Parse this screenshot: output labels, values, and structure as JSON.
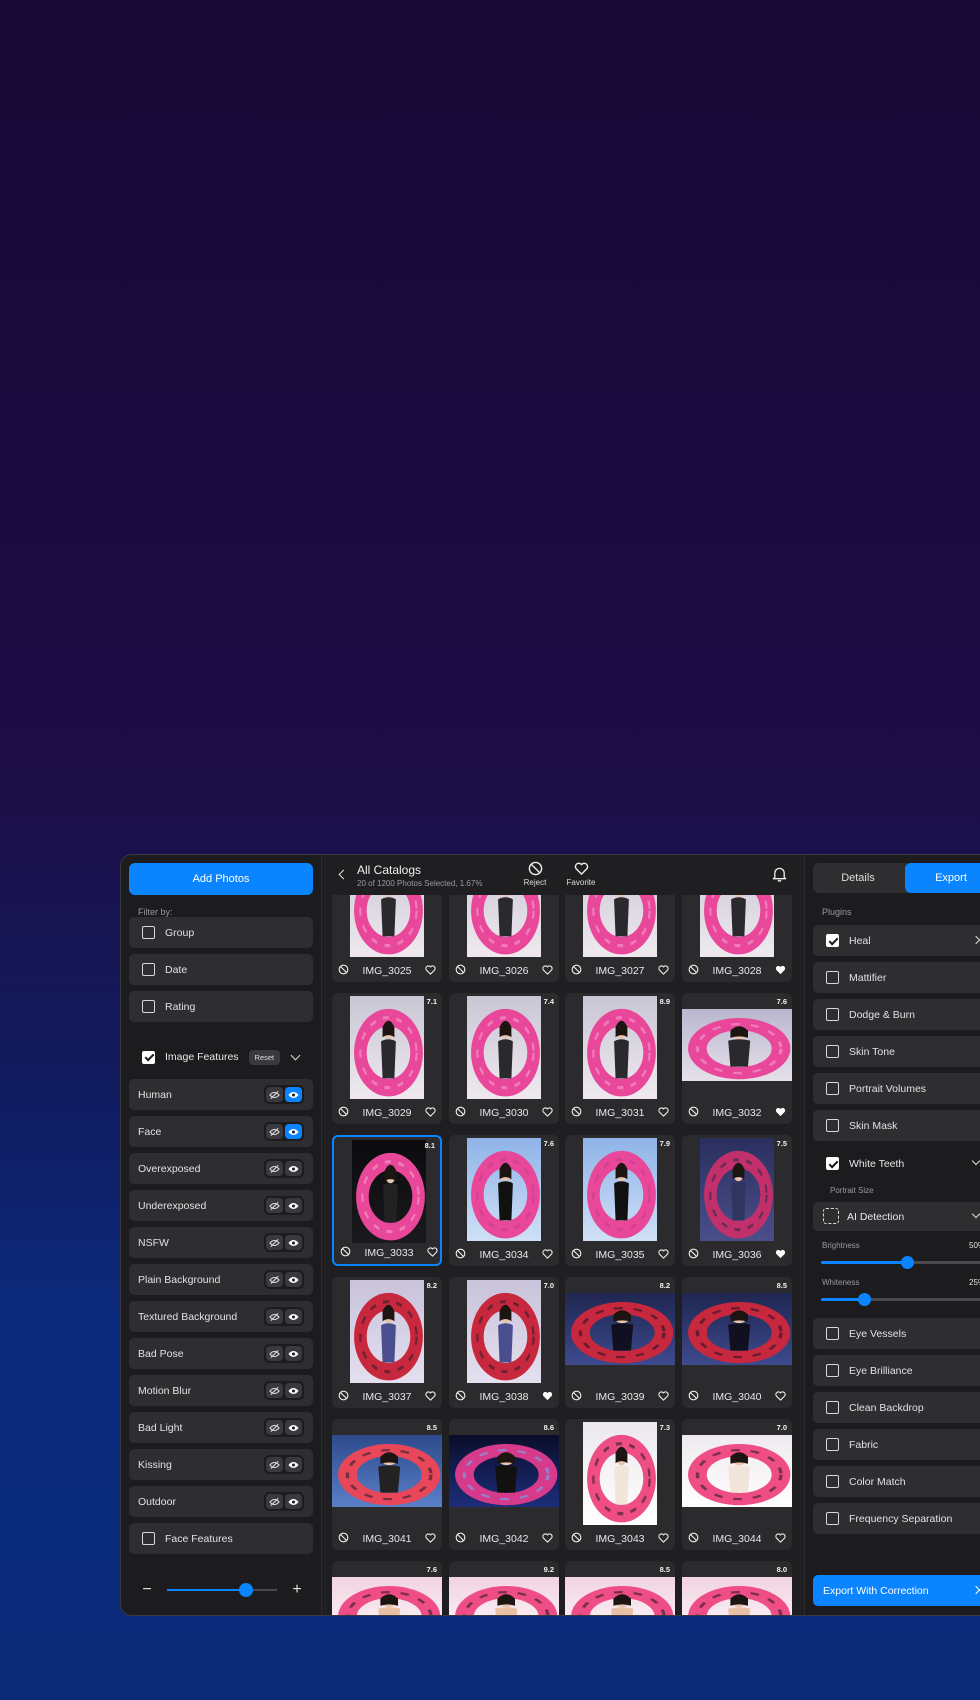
{
  "sidebar": {
    "add_photos": "Add Photos",
    "filter_by": "Filter by:",
    "filters": [
      {
        "label": "Group",
        "checked": false
      },
      {
        "label": "Date",
        "checked": false
      },
      {
        "label": "Rating",
        "checked": false
      }
    ],
    "image_features": {
      "label": "Image Features",
      "checked": true,
      "reset": "Reset"
    },
    "features": [
      {
        "label": "Human",
        "visible": true
      },
      {
        "label": "Face",
        "visible": true
      },
      {
        "label": "Overexposed",
        "visible": false
      },
      {
        "label": "Underexposed",
        "visible": false
      },
      {
        "label": "NSFW",
        "visible": false
      },
      {
        "label": "Plain Background",
        "visible": false
      },
      {
        "label": "Textured Background",
        "visible": false
      },
      {
        "label": "Bad Pose",
        "visible": false
      },
      {
        "label": "Motion Blur",
        "visible": false
      },
      {
        "label": "Bad Light",
        "visible": false
      },
      {
        "label": "Kissing",
        "visible": false
      },
      {
        "label": "Outdoor",
        "visible": false
      }
    ],
    "face_features": {
      "label": "Face Features",
      "checked": false
    },
    "zoom": {
      "minus": "−",
      "plus": "+",
      "level": 0.72
    }
  },
  "header": {
    "title": "All Catalogs",
    "subtitle": "20 of 1200 Photos Selected, 1.67%",
    "reject": "Reject",
    "favorite": "Favorite"
  },
  "photos": [
    {
      "name": "IMG_3025",
      "score": "",
      "fav": false,
      "tone": "light"
    },
    {
      "name": "IMG_3026",
      "score": "",
      "fav": false,
      "tone": "light"
    },
    {
      "name": "IMG_3027",
      "score": "",
      "fav": false,
      "tone": "light"
    },
    {
      "name": "IMG_3028",
      "score": "",
      "fav": true,
      "tone": "light"
    },
    {
      "name": "IMG_3029",
      "score": "7.1",
      "fav": false,
      "tone": "light"
    },
    {
      "name": "IMG_3030",
      "score": "7.4",
      "fav": false,
      "tone": "light"
    },
    {
      "name": "IMG_3031",
      "score": "8.9",
      "fav": false,
      "tone": "light"
    },
    {
      "name": "IMG_3032",
      "score": "7.6",
      "fav": true,
      "tone": "wide-light"
    },
    {
      "name": "IMG_3033",
      "score": "8.1",
      "fav": false,
      "tone": "dark",
      "selected": true
    },
    {
      "name": "IMG_3034",
      "score": "7.6",
      "fav": false,
      "tone": "blue"
    },
    {
      "name": "IMG_3035",
      "score": "7.9",
      "fav": false,
      "tone": "blue"
    },
    {
      "name": "IMG_3036",
      "score": "7.5",
      "fav": true,
      "tone": "navy"
    },
    {
      "name": "IMG_3037",
      "score": "8.2",
      "fav": false,
      "tone": "ring"
    },
    {
      "name": "IMG_3038",
      "score": "7.0",
      "fav": true,
      "tone": "ring"
    },
    {
      "name": "IMG_3039",
      "score": "8.2",
      "fav": false,
      "tone": "wide-navy"
    },
    {
      "name": "IMG_3040",
      "score": "8.5",
      "fav": false,
      "tone": "wide-navy"
    },
    {
      "name": "IMG_3041",
      "score": "8.5",
      "fav": false,
      "tone": "wide-ring"
    },
    {
      "name": "IMG_3042",
      "score": "8.6",
      "fav": false,
      "tone": "wide-dark"
    },
    {
      "name": "IMG_3043",
      "score": "7.3",
      "fav": false,
      "tone": "flamingo"
    },
    {
      "name": "IMG_3044",
      "score": "7.0",
      "fav": false,
      "tone": "wide-flamingo"
    },
    {
      "name": "",
      "score": "7.6",
      "fav": false,
      "tone": "wide-face"
    },
    {
      "name": "",
      "score": "9.2",
      "fav": false,
      "tone": "wide-face"
    },
    {
      "name": "",
      "score": "8.5",
      "fav": false,
      "tone": "wide-face"
    },
    {
      "name": "",
      "score": "8.0",
      "fav": false,
      "tone": "wide-face"
    }
  ],
  "right_panel": {
    "tabs": [
      "Details",
      "Export"
    ],
    "active_tab": "Export",
    "plugins_label": "Plugins",
    "plugins_top": [
      {
        "label": "Heal",
        "checked": true
      },
      {
        "label": "Mattifier",
        "checked": false
      },
      {
        "label": "Dodge & Burn",
        "checked": false
      },
      {
        "label": "Skin Tone",
        "checked": false
      },
      {
        "label": "Portrait Volumes",
        "checked": false
      },
      {
        "label": "Skin Mask",
        "checked": false
      }
    ],
    "white_teeth": {
      "label": "White Teeth",
      "checked": true,
      "portrait_size": "Portrait Size",
      "ai_detection": "AI Detection",
      "brightness_label": "Brightness",
      "brightness_value": "50%",
      "brightness": 0.5,
      "whiteness_label": "Whiteness",
      "whiteness_value": "25%",
      "whiteness": 0.25
    },
    "plugins_bottom": [
      {
        "label": "Eye Vessels",
        "checked": false
      },
      {
        "label": "Eye Brilliance",
        "checked": false
      },
      {
        "label": "Clean Backdrop",
        "checked": false
      },
      {
        "label": "Fabric",
        "checked": false
      },
      {
        "label": "Color Match",
        "checked": false
      },
      {
        "label": "Frequency Separation",
        "checked": false
      }
    ],
    "export_button": "Export With Correction"
  },
  "colors": {
    "accent": "#0a84ff",
    "panel": "#1c1c1e",
    "card": "#2b2b2e",
    "pink": "#e8479a"
  }
}
